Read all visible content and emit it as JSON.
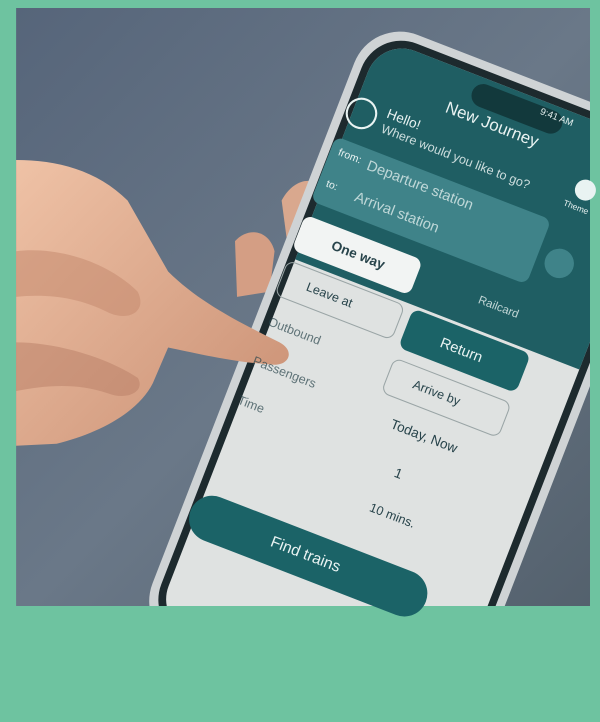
{
  "colors": {
    "frame": "#6ec3a0",
    "wall": "#5f6e7d",
    "phone_body": "#c8cdd0",
    "screen_header": "#1f5e63",
    "screen_body": "#dfe2e1",
    "accent": "#1b6367",
    "skin": "#e3b49a"
  },
  "app": {
    "status_time": "9:41 AM",
    "title": "New Journey",
    "greeting": "Hello!",
    "prompt": "Where would you like to go?",
    "theme_label": "Theme",
    "from_label": "from:",
    "from_placeholder": "Departure station",
    "to_label": "to:",
    "to_placeholder": "Arrival station",
    "one_way": "One way",
    "return": "Return",
    "railcard": "Railcard",
    "leave_at": "Leave at",
    "arrive_by": "Arrive by",
    "outbound_label": "Outbound",
    "outbound_value": "Today, Now",
    "passengers_label": "Passengers",
    "passengers_count": "1",
    "time_label": "Time",
    "time_value": "10 mins.",
    "find_button": "Find trains"
  }
}
